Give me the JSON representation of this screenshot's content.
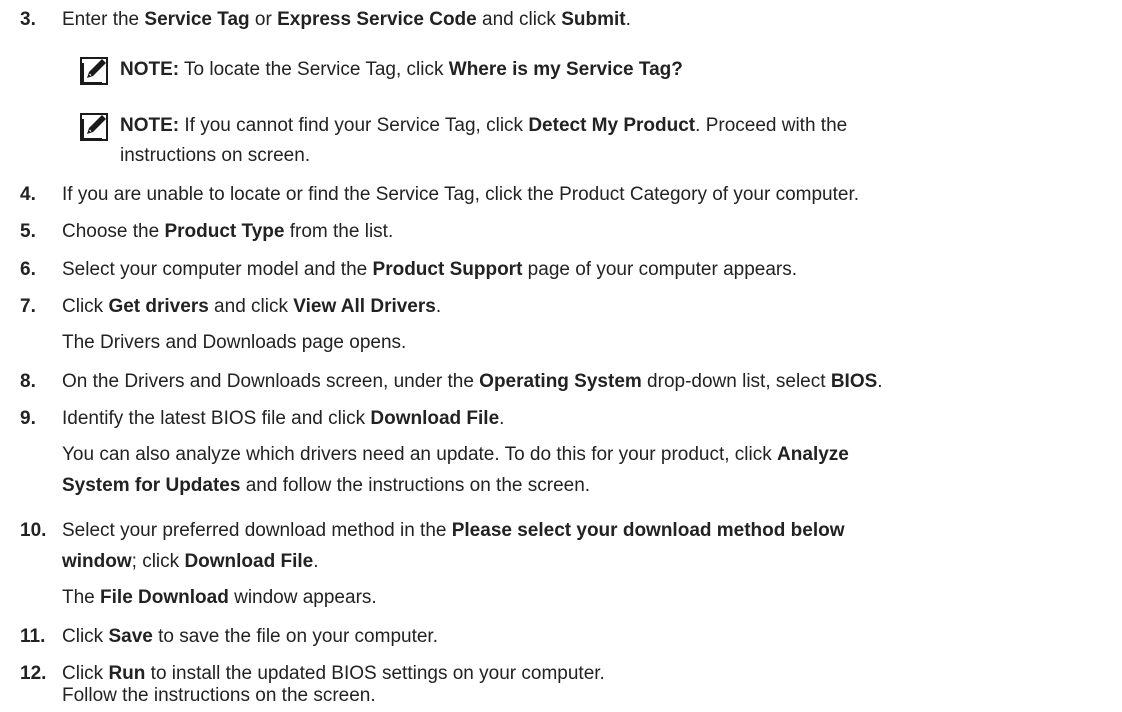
{
  "steps": {
    "s3": {
      "num": "3.",
      "t1": "Enter the ",
      "b1": "Service Tag",
      "t2": " or ",
      "b2": "Express Service Code",
      "t3": " and click ",
      "b3": "Submit",
      "t4": "."
    },
    "note1": {
      "label": "NOTE:",
      "t1": " To locate the Service Tag, click ",
      "b1": "Where is my Service Tag?"
    },
    "note2": {
      "label": "NOTE:",
      "t1": " If you cannot find your Service Tag, click ",
      "b1": "Detect My Product",
      "t2": ". Proceed with the",
      "line2": "instructions on screen."
    },
    "s4": {
      "num": "4.",
      "t1": "If you are unable to locate or find the Service Tag, click the Product Category of your computer."
    },
    "s5": {
      "num": "5.",
      "t1": "Choose the ",
      "b1": "Product Type",
      "t2": " from the list."
    },
    "s6": {
      "num": "6.",
      "t1": "Select your computer model and the ",
      "b1": "Product Support",
      "t2": " page of your computer appears."
    },
    "s7": {
      "num": "7.",
      "t1": "Click ",
      "b1": "Get drivers",
      "t2": " and click ",
      "b2": "View All Drivers",
      "t3": ".",
      "line2": "The Drivers and Downloads page opens."
    },
    "s8": {
      "num": "8.",
      "t1": "On the Drivers and Downloads screen, under the ",
      "b1": "Operating System",
      "t2": " drop-down list, select ",
      "b2": "BIOS",
      "t3": "."
    },
    "s9": {
      "num": "9.",
      "t1": "Identify the latest BIOS file and click ",
      "b1": "Download File",
      "t2": ".",
      "l2a": "You can also analyze which drivers need an update. To do this for your product, click ",
      "l2b": "Analyze",
      "l3a": "System for Updates",
      "l3b": " and follow the instructions on the screen."
    },
    "s10": {
      "num": "10.",
      "t1": "Select your preferred download method in the ",
      "b1": "Please select your download method below",
      "b2": "window",
      "t2": "; click ",
      "b3": "Download File",
      "t3": ".",
      "l3a": "The ",
      "l3b": "File Download",
      "l3c": " window appears."
    },
    "s11": {
      "num": "11.",
      "t1": "Click ",
      "b1": "Save",
      "t2": " to save the file on your computer."
    },
    "s12": {
      "num": "12.",
      "t1": "Click ",
      "b1": "Run",
      "t2": " to install the updated BIOS settings on your computer.",
      "line2": "Follow the instructions on the screen."
    }
  },
  "icons": {
    "note": "pencil-note-icon"
  }
}
